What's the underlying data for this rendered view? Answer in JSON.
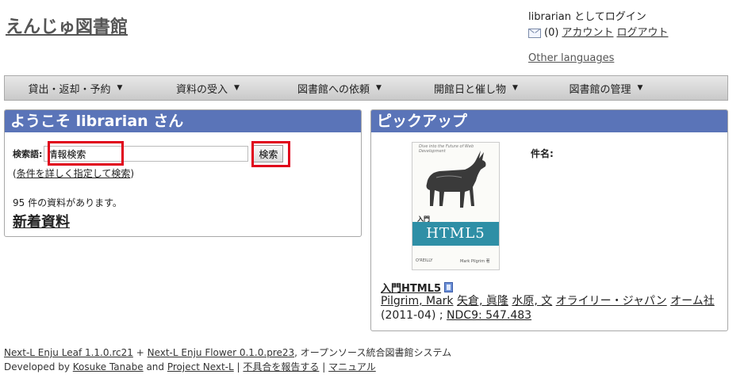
{
  "site": {
    "title": "えんじゅ図書館"
  },
  "user": {
    "login_text": "librarian としてログイン",
    "message_count": "(0)",
    "account_label": "アカウント",
    "logout_label": "ログアウト",
    "other_languages": "Other languages"
  },
  "nav": {
    "items": [
      {
        "label": "貸出・返却・予約"
      },
      {
        "label": "資料の受入"
      },
      {
        "label": "図書館への依頼"
      },
      {
        "label": "開館日と催し物"
      },
      {
        "label": "図書館の管理"
      }
    ]
  },
  "welcome": {
    "heading": "ようこそ librarian さん",
    "search_label": "検索語:",
    "search_value": "情報検索",
    "search_button": "検索",
    "adv_open": "(",
    "advanced_link": "条件を詳しく指定して検索",
    "adv_close": ")",
    "count_text": "95 件の資料があります。",
    "new_items": "新着資料"
  },
  "pickup": {
    "heading": "ピックアップ",
    "cover_tagline": "Dive into the Future of Web Development",
    "cover_intro": "入門",
    "cover_title": "HTML5",
    "cover_publisher": "O'REILLY",
    "cover_authors": "Mark Pilgrim 著",
    "field_label": "件名:",
    "book_title": "入門HTML5",
    "author1": "Pilgrim, Mark",
    "author2": "矢倉, 眞隆",
    "author3": "水原, 文",
    "publisher": "オライリー・ジャパン",
    "publisher2": "オーム社",
    "year": "(2011-04)",
    "separator": ";",
    "ndc": "NDC9: 547.483"
  },
  "footer": {
    "leaf": "Next-L Enju Leaf 1.1.0.rc21",
    "plus": "+",
    "flower": "Next-L Enju Flower 0.1.0.pre23",
    "suffix": ", オープンソース統合図書館システム",
    "developed_by": "Developed by",
    "author": "Kosuke Tanabe",
    "and": "and",
    "project": "Project Next-L",
    "sep": "|",
    "report": "不具合を報告する",
    "manual": "マニュアル"
  },
  "colors": {
    "panel_header": "#5a74b8",
    "highlight": "#e0001b",
    "cover_band": "#2f8fa6"
  }
}
